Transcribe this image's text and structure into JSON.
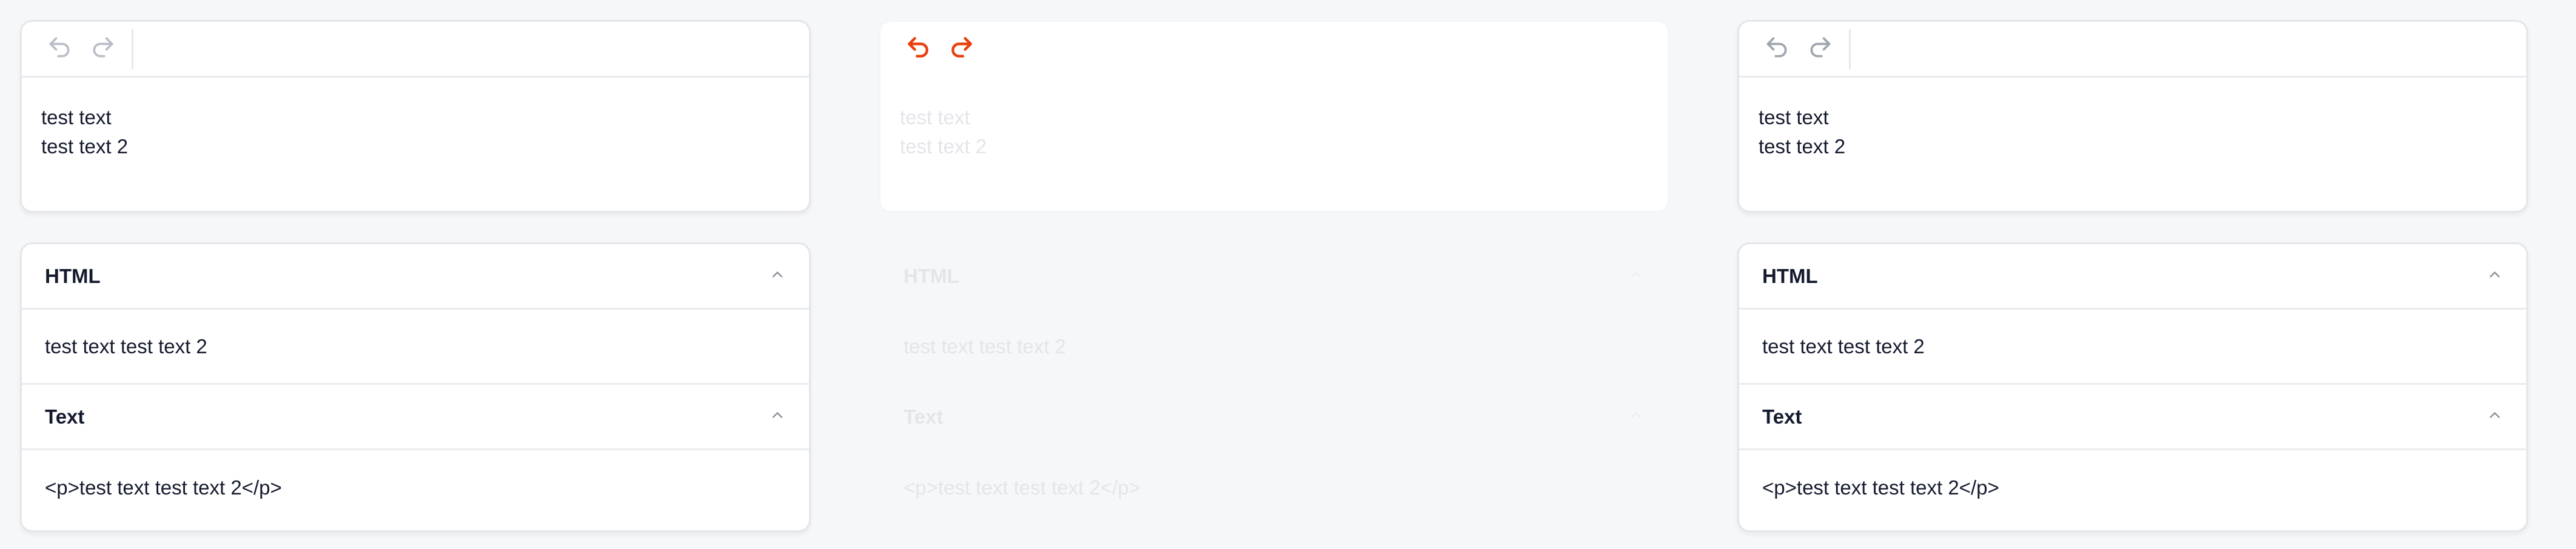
{
  "panels": [
    {
      "state": "normal",
      "toolbar": {
        "undo_icon": "undo-icon",
        "redo_icon": "redo-icon",
        "icon_color": "#b9bdc6"
      },
      "editor": {
        "lines": [
          "test text",
          "test text 2"
        ]
      },
      "html_section": {
        "title": "HTML",
        "content": "test text test text 2"
      },
      "text_section": {
        "title": "Text",
        "content": "<p>test text test text 2</p>"
      }
    },
    {
      "state": "faded",
      "toolbar": {
        "undo_icon": "undo-icon",
        "redo_icon": "redo-icon",
        "icon_color": "#e8400c"
      },
      "editor": {
        "lines": [
          "test text",
          "test text 2"
        ]
      },
      "html_section": {
        "title": "HTML",
        "content": "test text test text 2"
      },
      "text_section": {
        "title": "Text",
        "content": "<p>test text test text 2</p>"
      }
    },
    {
      "state": "normal",
      "toolbar": {
        "undo_icon": "undo-icon",
        "redo_icon": "redo-icon",
        "icon_color": "#b9bdc6"
      },
      "editor": {
        "lines": [
          "test text",
          "test text 2"
        ]
      },
      "html_section": {
        "title": "HTML",
        "content": "test text test text 2"
      },
      "text_section": {
        "title": "Text",
        "content": "<p>test text test text 2</p>"
      }
    }
  ],
  "colors": {
    "accent": "#e8400c",
    "text": "#141a2e",
    "border": "#e4e6ea"
  }
}
